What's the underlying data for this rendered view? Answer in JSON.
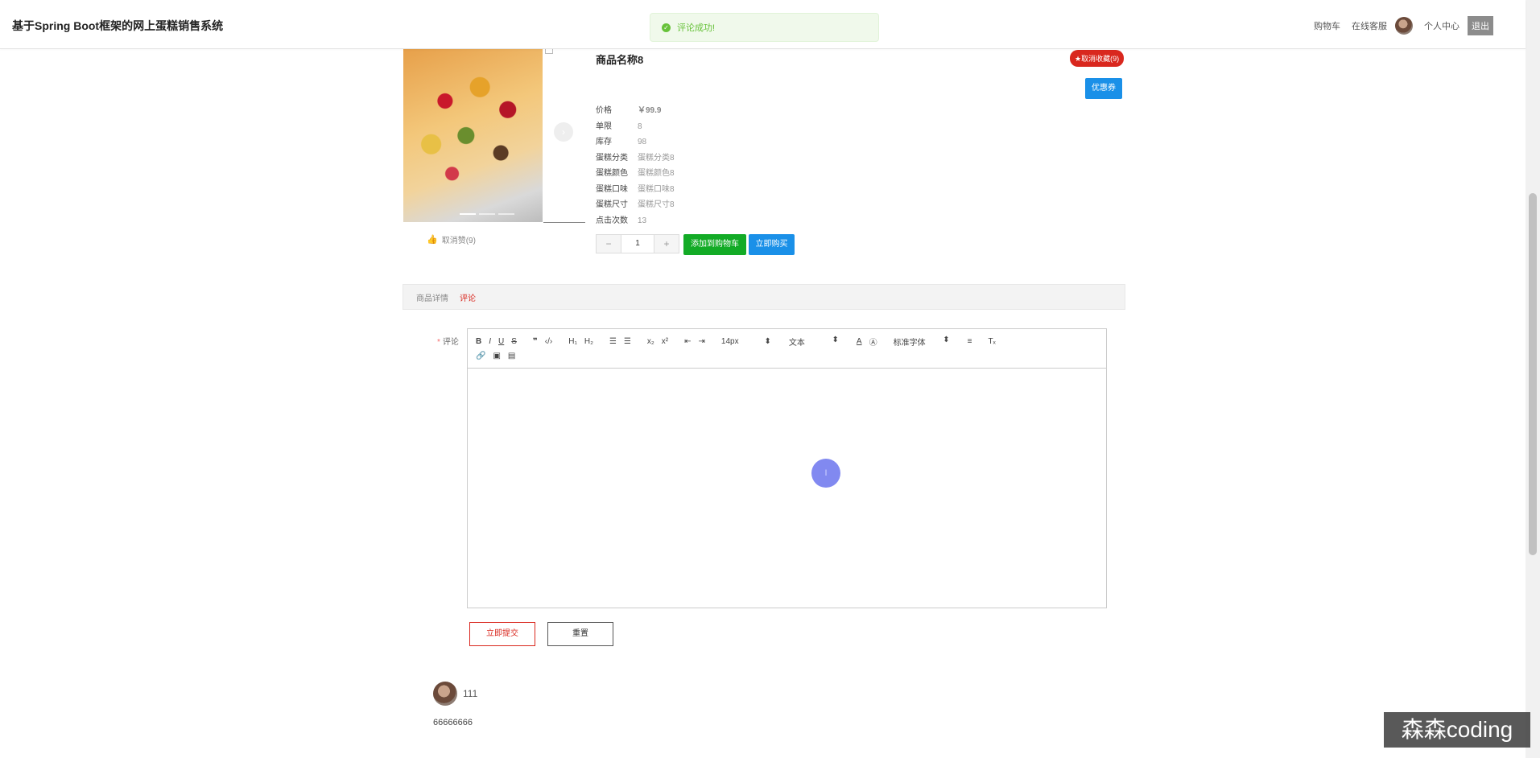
{
  "header": {
    "site_title": "基于Spring Boot框架的网上蛋糕销售系统",
    "nav": {
      "cart": "购物车",
      "service": "在线客服",
      "profile": "个人中心",
      "logout": "退出"
    }
  },
  "toast": {
    "message": "评论成功!"
  },
  "product": {
    "name": "商品名称8",
    "favorite_badge": "★取消收藏(9)",
    "coupon_button": "优惠券",
    "like_text": "取消赞(9)",
    "attributes": [
      {
        "label": "价格",
        "value": "￥99.9"
      },
      {
        "label": "单限",
        "value": "8"
      },
      {
        "label": "库存",
        "value": "98"
      },
      {
        "label": "蛋糕分类",
        "value": "蛋糕分类8"
      },
      {
        "label": "蛋糕颜色",
        "value": "蛋糕颜色8"
      },
      {
        "label": "蛋糕口味",
        "value": "蛋糕口味8"
      },
      {
        "label": "蛋糕尺寸",
        "value": "蛋糕尺寸8"
      },
      {
        "label": "点击次数",
        "value": "13"
      }
    ],
    "quantity": "1",
    "add_to_cart": "添加到购物车",
    "buy_now": "立即购买"
  },
  "tabs": {
    "detail": "商品详情",
    "comment": "评论"
  },
  "comment_form": {
    "label": "评论",
    "required_mark": "*",
    "toolbar": {
      "font_size": "14px",
      "header": "文本",
      "font": "标准字体"
    },
    "submit": "立即提交",
    "reset": "重置"
  },
  "comments": [
    {
      "user": "111",
      "text": "66666666"
    }
  ],
  "watermark": "森森coding"
}
